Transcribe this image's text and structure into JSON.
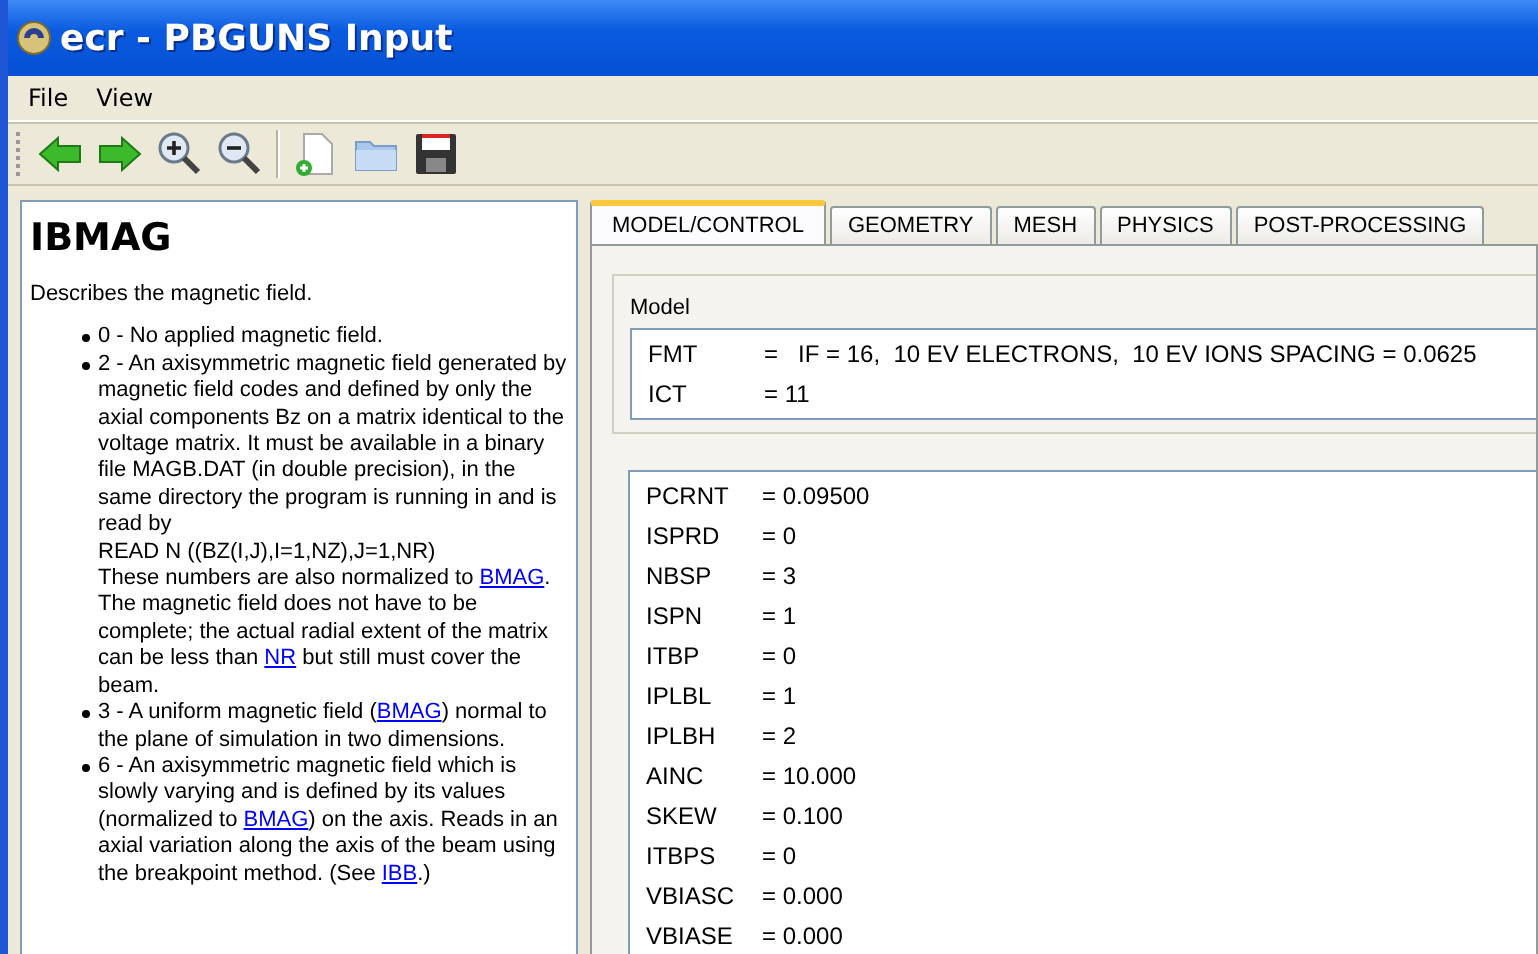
{
  "window": {
    "title": "ecr - PBGUNS Input"
  },
  "menu": [
    "File",
    "View"
  ],
  "toolbar": [
    {
      "kind": "back"
    },
    {
      "kind": "forward"
    },
    {
      "kind": "zoom-in"
    },
    {
      "kind": "zoom-out"
    },
    {
      "kind": "separator"
    },
    {
      "kind": "new"
    },
    {
      "kind": "open"
    },
    {
      "kind": "save"
    }
  ],
  "help": {
    "title": "IBMAG",
    "intro": "Describes the magnetic field.",
    "items": [
      {
        "parts": [
          {
            "text": "0 - No applied magnetic field."
          }
        ]
      },
      {
        "parts": [
          {
            "text": "2 - An axisymmetric magnetic field generated by magnetic field codes and defined by only the axial components Bz on a matrix identical to the voltage matrix. It must be available in a binary file MAGB.DAT (in double precision), in the same directory the program is running in and is read by\nREAD N ((BZ(I,J),I=1,NZ),J=1,NR)\nThese numbers are also normalized to "
          },
          {
            "link": "BMAG"
          },
          {
            "text": ". The magnetic field does not have to be complete; the actual radial extent of the matrix can be less than "
          },
          {
            "link": "NR"
          },
          {
            "text": " but still must cover the beam."
          }
        ]
      },
      {
        "parts": [
          {
            "text": "3 - A uniform magnetic field ("
          },
          {
            "link": "BMAG"
          },
          {
            "text": ") normal to the plane of simulation in two dimensions."
          }
        ]
      },
      {
        "parts": [
          {
            "text": "6 - An axisymmetric magnetic field which is slowly varying and is defined by its values (normalized to "
          },
          {
            "link": "BMAG"
          },
          {
            "text": ") on the axis. Reads in an axial variation along the axis of the beam using the breakpoint method. (See "
          },
          {
            "link": "IBB"
          },
          {
            "text": ".)"
          }
        ]
      }
    ]
  },
  "tabs": [
    {
      "label": "MODEL/CONTROL",
      "selected": true
    },
    {
      "label": "GEOMETRY",
      "selected": false
    },
    {
      "label": "MESH",
      "selected": false
    },
    {
      "label": "PHYSICS",
      "selected": false
    },
    {
      "label": "POST-PROCESSING",
      "selected": false
    }
  ],
  "model": {
    "label": "Model",
    "rows": [
      {
        "name": "FMT",
        "value": "=   IF = 16,  10 EV ELECTRONS,  10 EV IONS SPACING = 0.0625"
      },
      {
        "name": "ICT",
        "value": "= 11"
      }
    ]
  },
  "params": [
    {
      "name": "PCRNT",
      "value": "= 0.09500"
    },
    {
      "name": "ISPRD",
      "value": "= 0"
    },
    {
      "name": "NBSP",
      "value": "= 3"
    },
    {
      "name": "ISPN",
      "value": "= 1"
    },
    {
      "name": "ITBP",
      "value": "= 0"
    },
    {
      "name": "IPLBL",
      "value": "= 1"
    },
    {
      "name": "IPLBH",
      "value": "= 2"
    },
    {
      "name": "AINC",
      "value": "= 10.000"
    },
    {
      "name": "SKEW",
      "value": "= 0.100"
    },
    {
      "name": "ITBPS",
      "value": "= 0"
    },
    {
      "name": "VBIASC",
      "value": "= 0.000"
    },
    {
      "name": "VBIASE",
      "value": "= 0.000"
    }
  ]
}
